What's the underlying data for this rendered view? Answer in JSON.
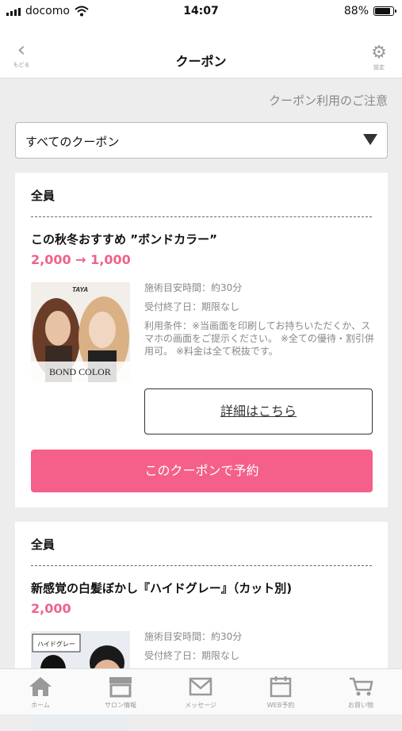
{
  "status": {
    "carrier": "docomo",
    "time": "14:07",
    "battery": "88%",
    "battery_level": 0.88
  },
  "nav": {
    "back_label": "もどる",
    "title": "クーポン",
    "settings_label": "設定"
  },
  "notice_link": "クーポン利用のご注意",
  "filter": {
    "selected": "すべてのクーポン"
  },
  "coupons": [
    {
      "audience": "全員",
      "name": "この秋冬おすすめ ”ボンドカラー”",
      "price": "2,000 → 1,000",
      "image_text": {
        "brand": "TAYA",
        "caption": "BOND COLOR"
      },
      "duration": "施術目安時間：約30分",
      "deadline": "受付終了日：期限なし",
      "terms": "利用条件：※当画面を印刷してお持ちいただくか、スマホの画面をご提示ください。 ※全ての優待・割引併用可。 ※料金は全て税抜です。",
      "detail_label": "詳細はこちら",
      "reserve_label": "このクーポンで予約"
    },
    {
      "audience": "全員",
      "name": "新感覚の白髪ぼかし『ハイドグレー』（カット別)",
      "price": "2,000",
      "image_text": {
        "caption": "ハイドグレー"
      },
      "duration": "施術目安時間：約30分",
      "deadline": "受付終了日：期限なし"
    }
  ],
  "tabs": [
    {
      "label": "ホーム",
      "icon": "home-icon"
    },
    {
      "label": "サロン情報",
      "icon": "shop-icon"
    },
    {
      "label": "メッセージ",
      "icon": "mail-icon"
    },
    {
      "label": "WEB予約",
      "icon": "calendar-icon"
    },
    {
      "label": "お買い物",
      "icon": "cart-icon"
    }
  ],
  "colors": {
    "accent": "#f4608a",
    "price": "#f0628a",
    "background": "#ededed"
  }
}
